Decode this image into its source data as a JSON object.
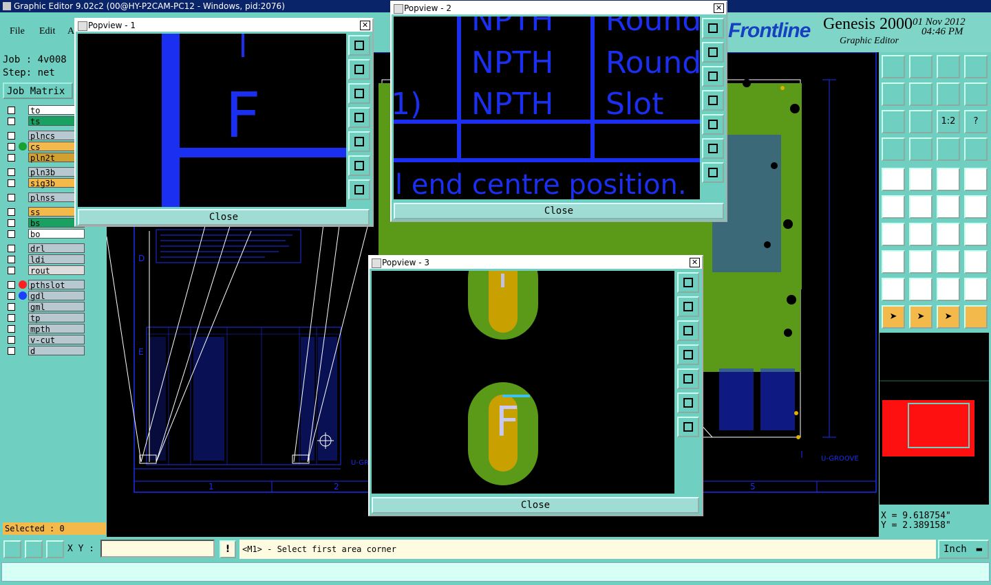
{
  "window": {
    "title": "Graphic Editor 9.02c2 (00@HY-P2CAM-PC12 - Windows, pid:2076)"
  },
  "menu": {
    "file": "File",
    "edit": "Edit",
    "a": "A"
  },
  "brand": {
    "frontline": "Frontline",
    "product": "Genesis 2000",
    "module": "Graphic Editor",
    "date": "01 Nov 2012",
    "time": "04:46 PM"
  },
  "job": {
    "job_label": "Job : 4v008",
    "step_label": "Step: net",
    "matrix_button": "Job Matrix"
  },
  "layers": [
    {
      "name": "to",
      "color": "#ffffff",
      "dot": ""
    },
    {
      "name": "ts",
      "color": "#1aa060",
      "dot": ""
    },
    {
      "name": "plncs",
      "color": "#b8c8d0",
      "dot": ""
    },
    {
      "name": "cs",
      "color": "#f3b94a",
      "dot": "#1aa030"
    },
    {
      "name": "pln2t",
      "color": "#d0a030",
      "dot": ""
    },
    {
      "name": "pln3b",
      "color": "#b8c8d0",
      "dot": ""
    },
    {
      "name": "sig3b",
      "color": "#f3b94a",
      "dot": ""
    },
    {
      "name": "plnss",
      "color": "#b8c8d0",
      "dot": ""
    },
    {
      "name": "ss",
      "color": "#f3b94a",
      "dot": ""
    },
    {
      "name": "bs",
      "color": "#1aa060",
      "dot": ""
    },
    {
      "name": "bo",
      "color": "#ffffff",
      "dot": ""
    },
    {
      "name": "drl",
      "color": "#b8c8d0",
      "dot": ""
    },
    {
      "name": "ldi",
      "color": "#b8c8d0",
      "dot": ""
    },
    {
      "name": "rout",
      "color": "#dddddd",
      "dot": ""
    },
    {
      "name": "pthslot",
      "color": "#b8c8d0",
      "dot": "#ff2020"
    },
    {
      "name": "gdl",
      "color": "#b8c8d0",
      "dot": "#1a40ff"
    },
    {
      "name": "gml",
      "color": "#b8c8d0",
      "dot": ""
    },
    {
      "name": "tp",
      "color": "#b8c8d0",
      "dot": ""
    },
    {
      "name": "mpth",
      "color": "#b8c8d0",
      "dot": ""
    },
    {
      "name": "v-cut",
      "color": "#b8c8d0",
      "dot": ""
    },
    {
      "name": "d",
      "color": "#b8c8d0",
      "dot": ""
    }
  ],
  "selected": "Selected : 0",
  "popups": {
    "p1": {
      "title": "Popview - 1",
      "close": "Close",
      "letter": "F"
    },
    "p2": {
      "title": "Popview - 2",
      "close": "Close",
      "row1a": "NPTH",
      "row1b": "Round",
      "row2a": "NPTH",
      "row2b": "Round",
      "row3a": "NPTH",
      "row3b": "Slot",
      "row3c": "1)",
      "note": "l end centre position."
    },
    "p3": {
      "title": "Popview - 3",
      "close": "Close",
      "letter": "F"
    }
  },
  "canvas": {
    "u_groove": "U-GROOVE",
    "grid_numbers": [
      "1",
      "2",
      "5"
    ],
    "side_letters": [
      "D",
      "E"
    ]
  },
  "coords": {
    "x": "X = 9.618754\"",
    "y": "Y = 2.389158\""
  },
  "bottom": {
    "xy_label": "X Y :",
    "prompt": "<M1> - Select first area corner",
    "units": "Inch"
  },
  "colors": {
    "background": "#6fcfc0",
    "accent_blue": "#1a2ff0",
    "pcb_green": "#5a9a18",
    "selected_orange": "#f3b94a"
  }
}
